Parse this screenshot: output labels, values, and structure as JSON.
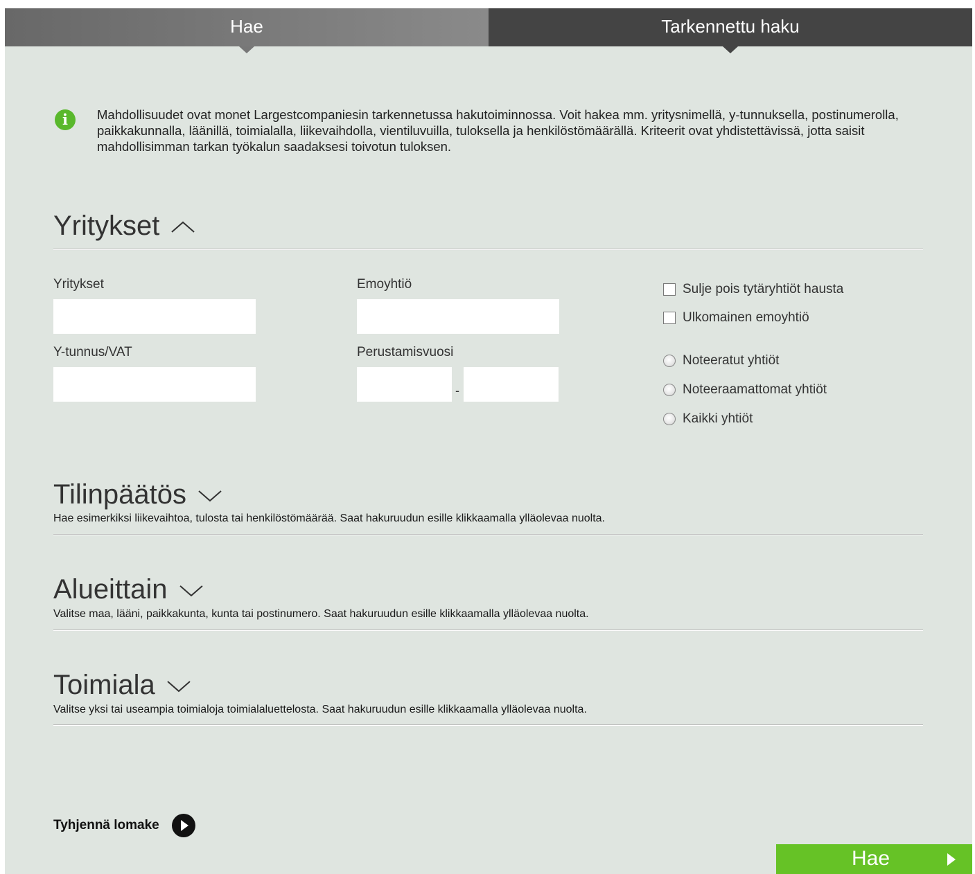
{
  "tabs": [
    {
      "label": "Hae"
    },
    {
      "label": "Tarkennettu haku"
    }
  ],
  "info": {
    "icon": "info-icon",
    "glyph": "i",
    "text": "Mahdollisuudet ovat monet Largestcompaniesin tarkennetussa hakutoiminnossa. Voit hakea mm. yritysnimellä, y-tunnuksella, postinumerolla, paikkakunnalla, läänillä, toimialalla, liikevaihdolla, vientiluvuilla, tuloksella ja henkilöstömäärällä. Kriteerit ovat yhdistettävissä, jotta saisit mahdollisimman tarkan työkalun saadaksesi toivotun tuloksen."
  },
  "sections": {
    "companies": {
      "title": "Yritykset",
      "fields": {
        "company_label": "Yritykset",
        "company_value": "",
        "parent_label": "Emoyhtiö",
        "parent_value": "",
        "vat_label": "Y-tunnus/VAT",
        "vat_value": "",
        "founded_label": "Perustamisvuosi",
        "founded_from": "",
        "founded_sep": "-",
        "founded_to": ""
      },
      "checkboxes": [
        {
          "label": "Sulje pois tytäryhtiöt hausta",
          "checked": false
        },
        {
          "label": "Ulkomainen emoyhtiö",
          "checked": false
        }
      ],
      "radios": [
        {
          "label": "Noteeratut yhtiöt",
          "selected": false
        },
        {
          "label": "Noteeraamattomat yhtiöt",
          "selected": false
        },
        {
          "label": "Kaikki yhtiöt",
          "selected": false
        }
      ]
    },
    "financials": {
      "title": "Tilinpäätös",
      "description": "Hae esimerkiksi liikevaihtoa, tulosta tai henkilöstömäärää. Saat hakuruudun esille klikkaamalla ylläolevaa nuolta."
    },
    "regions": {
      "title": "Alueittain",
      "description": "Valitse maa, lääni, paikkakunta, kunta tai postinumero. Saat hakuruudun esille klikkaamalla ylläolevaa nuolta."
    },
    "industry": {
      "title": "Toimiala",
      "description": "Valitse yksi tai useampia toimialoja toimialaluettelosta. Saat hakuruudun esille klikkaamalla ylläolevaa nuolta."
    }
  },
  "actions": {
    "clear_label": "Tyhjennä lomake",
    "submit_label": "Hae"
  },
  "colors": {
    "panel_bg": "#dfe5e0",
    "tab_active": "#444444",
    "accent_green": "#66c226",
    "info_green": "#59b82c"
  }
}
